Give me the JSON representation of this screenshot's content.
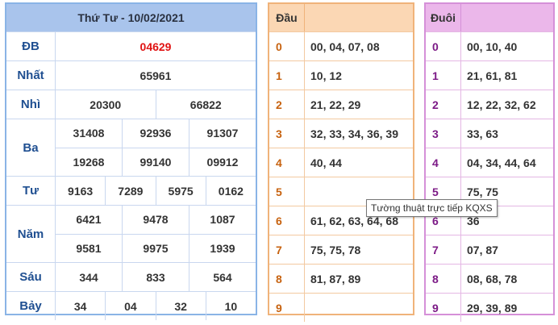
{
  "results": {
    "title": "Thứ Tư - 10/02/2021",
    "prizes": [
      {
        "label": "ĐB",
        "lines": [
          [
            "04629"
          ]
        ],
        "special": true
      },
      {
        "label": "Nhất",
        "lines": [
          [
            "65961"
          ]
        ]
      },
      {
        "label": "Nhì",
        "lines": [
          [
            "20300",
            "66822"
          ]
        ]
      },
      {
        "label": "Ba",
        "lines": [
          [
            "31408",
            "92936",
            "91307"
          ],
          [
            "19268",
            "99140",
            "09912"
          ]
        ]
      },
      {
        "label": "Tư",
        "lines": [
          [
            "9163",
            "7289",
            "5975",
            "0162"
          ]
        ]
      },
      {
        "label": "Năm",
        "lines": [
          [
            "6421",
            "9478",
            "1087"
          ],
          [
            "9581",
            "9975",
            "1939"
          ]
        ]
      },
      {
        "label": "Sáu",
        "lines": [
          [
            "344",
            "833",
            "564"
          ]
        ]
      },
      {
        "label": "Bảy",
        "lines": [
          [
            "34",
            "04",
            "32",
            "10"
          ]
        ]
      }
    ]
  },
  "dau": {
    "header": "Đầu",
    "rows": [
      {
        "key": "0",
        "values": "00, 04, 07, 08"
      },
      {
        "key": "1",
        "values": "10, 12"
      },
      {
        "key": "2",
        "values": "21, 22, 29"
      },
      {
        "key": "3",
        "values": "32, 33, 34, 36, 39"
      },
      {
        "key": "4",
        "values": "40, 44"
      },
      {
        "key": "5",
        "values": ""
      },
      {
        "key": "6",
        "values": "61, 62, 63, 64, 68"
      },
      {
        "key": "7",
        "values": "75, 75, 78"
      },
      {
        "key": "8",
        "values": "81, 87, 89"
      },
      {
        "key": "9",
        "values": ""
      }
    ]
  },
  "duoi": {
    "header": "Đuôi",
    "rows": [
      {
        "key": "0",
        "values": "00, 10, 40"
      },
      {
        "key": "1",
        "values": "21, 61, 81"
      },
      {
        "key": "2",
        "values": "12, 22, 32, 62"
      },
      {
        "key": "3",
        "values": "33, 63"
      },
      {
        "key": "4",
        "values": "04, 34, 44, 64"
      },
      {
        "key": "5",
        "values": "75, 75"
      },
      {
        "key": "6",
        "values": "36"
      },
      {
        "key": "7",
        "values": "07, 87"
      },
      {
        "key": "8",
        "values": "08, 68, 78"
      },
      {
        "key": "9",
        "values": "29, 39, 89"
      }
    ]
  },
  "tooltip": {
    "text": "Tường thuật trực tiếp KQXS"
  },
  "colors": {
    "results_border": "#8ab4e6",
    "results_header": "#a9c4ec",
    "special_prize": "#e01212",
    "dau_header": "#fbd7b4",
    "dau_key": "#c7620f",
    "duoi_header": "#ebb7ea",
    "duoi_key": "#7c1a86"
  }
}
